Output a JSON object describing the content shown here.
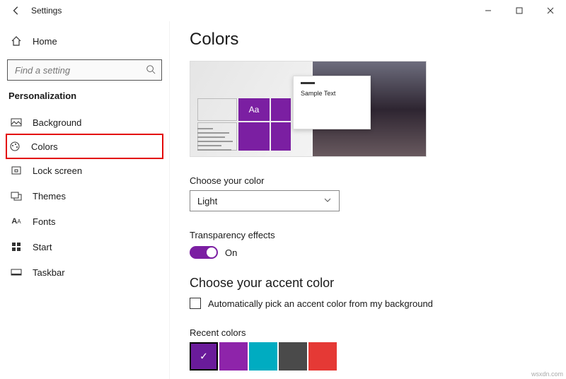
{
  "app": {
    "title": "Settings"
  },
  "sidebar": {
    "home": "Home",
    "search_placeholder": "Find a setting",
    "section": "Personalization",
    "items": [
      {
        "label": "Background"
      },
      {
        "label": "Colors"
      },
      {
        "label": "Lock screen"
      },
      {
        "label": "Themes"
      },
      {
        "label": "Fonts"
      },
      {
        "label": "Start"
      },
      {
        "label": "Taskbar"
      }
    ]
  },
  "page": {
    "title": "Colors",
    "preview_sample": "Sample Text",
    "preview_aa": "Aa",
    "choose_color_label": "Choose your color",
    "choose_color_value": "Light",
    "transparency_label": "Transparency effects",
    "transparency_value": "On",
    "accent_heading": "Choose your accent color",
    "auto_pick_label": "Automatically pick an accent color from my background",
    "recent_label": "Recent colors",
    "recent_colors": [
      "#6a1b9a",
      "#8e24aa",
      "#00acc1",
      "#4a4a4a",
      "#e53935"
    ]
  },
  "watermark": "wsxdn.com"
}
